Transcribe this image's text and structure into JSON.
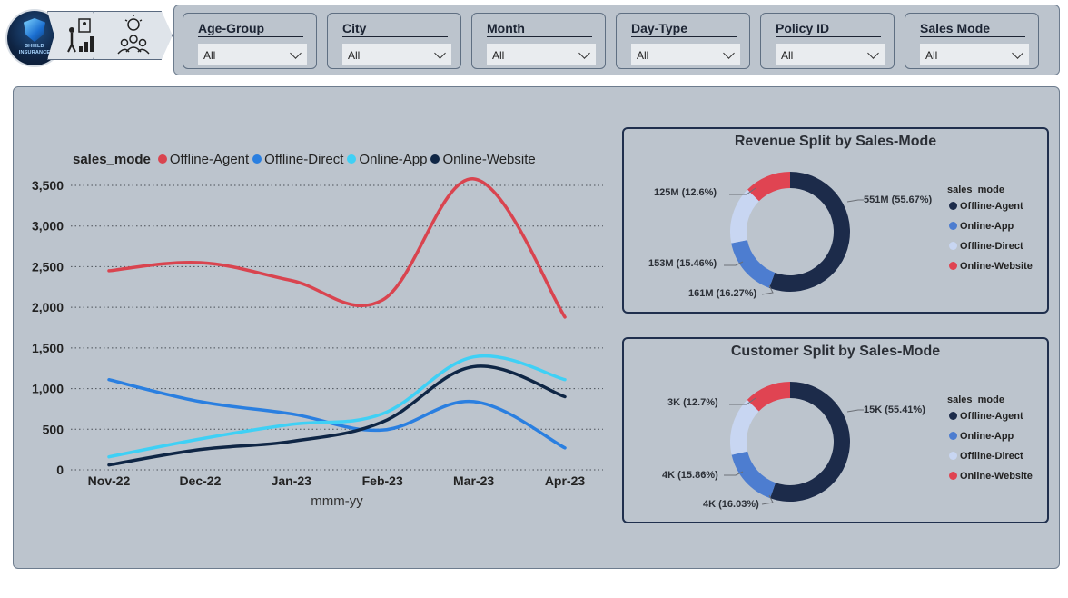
{
  "nav": {
    "logo_text": [
      "SHIELD",
      "INSURANCE"
    ],
    "icons": [
      "report-growth-icon",
      "team-idea-icon"
    ]
  },
  "slicers": [
    {
      "title": "Age-Group",
      "value": "All"
    },
    {
      "title": "City",
      "value": "All"
    },
    {
      "title": "Month",
      "value": "All"
    },
    {
      "title": "Day-Type",
      "value": "All"
    },
    {
      "title": "Policy ID",
      "value": "All"
    },
    {
      "title": "Sales Mode",
      "value": "All"
    }
  ],
  "colors": {
    "offline_agent": "#d9444f",
    "offline_direct": "#2a7fe0",
    "online_app": "#3fd0f5",
    "online_website": "#0f2645",
    "donut_offline_agent": "#1c2b4a",
    "donut_online_app": "#4d7dd0",
    "donut_offline_direct": "#c8d6f2",
    "donut_online_website": "#e04452"
  },
  "chart_data": [
    {
      "type": "line",
      "legend_title": "sales_mode",
      "xlabel": "mmm-yy",
      "ylabel": "",
      "x": [
        "Nov-22",
        "Dec-22",
        "Jan-23",
        "Feb-23",
        "Mar-23",
        "Apr-23"
      ],
      "ylim": [
        0,
        3500
      ],
      "yticks": [
        "0",
        "500",
        "1,000",
        "1,500",
        "2,000",
        "2,500",
        "3,000",
        "3,500"
      ],
      "grid": "horizontal-dotted",
      "series": [
        {
          "name": "Offline-Agent",
          "values": [
            2450,
            2550,
            2330,
            2090,
            3580,
            1880
          ]
        },
        {
          "name": "Offline-Direct",
          "values": [
            1110,
            840,
            690,
            490,
            840,
            270
          ]
        },
        {
          "name": "Online-App",
          "values": [
            160,
            380,
            560,
            690,
            1390,
            1110
          ]
        },
        {
          "name": "Online-Website",
          "values": [
            60,
            250,
            350,
            590,
            1270,
            900
          ]
        }
      ]
    },
    {
      "type": "pie",
      "title": "Revenue Split by Sales-Mode",
      "legend_title": "sales_mode",
      "legend": [
        "Offline-Agent",
        "Online-App",
        "Offline-Direct",
        "Online-Website"
      ],
      "slices": [
        {
          "name": "Offline-Agent",
          "value": 55.67,
          "label": "551M (55.67%)"
        },
        {
          "name": "Online-App",
          "value": 16.27,
          "label": "161M (16.27%)"
        },
        {
          "name": "Offline-Direct",
          "value": 15.46,
          "label": "153M (15.46%)"
        },
        {
          "name": "Online-Website",
          "value": 12.6,
          "label": "125M (12.6%)"
        }
      ]
    },
    {
      "type": "pie",
      "title": "Customer Split by Sales-Mode",
      "legend_title": "sales_mode",
      "legend": [
        "Offline-Agent",
        "Online-App",
        "Offline-Direct",
        "Online-Website"
      ],
      "slices": [
        {
          "name": "Offline-Agent",
          "value": 55.41,
          "label": "15K (55.41%)"
        },
        {
          "name": "Online-App",
          "value": 16.03,
          "label": "4K (16.03%)"
        },
        {
          "name": "Offline-Direct",
          "value": 15.86,
          "label": "4K (15.86%)"
        },
        {
          "name": "Online-Website",
          "value": 12.7,
          "label": "3K (12.7%)"
        }
      ]
    }
  ]
}
